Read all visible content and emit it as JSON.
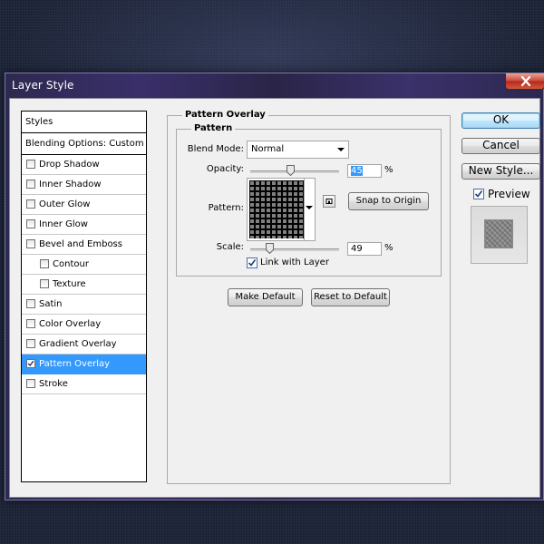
{
  "window": {
    "title": "Layer Style"
  },
  "styles_list": {
    "header": "Styles",
    "blending_options": "Blending Options: Custom",
    "items": [
      {
        "label": "Drop Shadow",
        "checked": false,
        "indent": false,
        "selected": false
      },
      {
        "label": "Inner Shadow",
        "checked": false,
        "indent": false,
        "selected": false
      },
      {
        "label": "Outer Glow",
        "checked": false,
        "indent": false,
        "selected": false
      },
      {
        "label": "Inner Glow",
        "checked": false,
        "indent": false,
        "selected": false
      },
      {
        "label": "Bevel and Emboss",
        "checked": false,
        "indent": false,
        "selected": false
      },
      {
        "label": "Contour",
        "checked": false,
        "indent": true,
        "selected": false
      },
      {
        "label": "Texture",
        "checked": false,
        "indent": true,
        "selected": false
      },
      {
        "label": "Satin",
        "checked": false,
        "indent": false,
        "selected": false
      },
      {
        "label": "Color Overlay",
        "checked": false,
        "indent": false,
        "selected": false
      },
      {
        "label": "Gradient Overlay",
        "checked": false,
        "indent": false,
        "selected": false
      },
      {
        "label": "Pattern Overlay",
        "checked": true,
        "indent": false,
        "selected": true
      },
      {
        "label": "Stroke",
        "checked": false,
        "indent": false,
        "selected": false
      }
    ]
  },
  "pattern_overlay": {
    "group_title": "Pattern Overlay",
    "subgroup_title": "Pattern",
    "blend_mode_label": "Blend Mode:",
    "blend_mode_value": "Normal",
    "opacity_label": "Opacity:",
    "opacity_value": "45",
    "opacity_unit": "%",
    "opacity_fraction": 0.45,
    "pattern_label": "Pattern:",
    "snap_to_origin": "Snap to Origin",
    "scale_label": "Scale:",
    "scale_value": "49",
    "scale_unit": "%",
    "scale_fraction": 0.22,
    "link_with_layer": "Link with Layer",
    "link_checked": true,
    "make_default": "Make Default",
    "reset_to_default": "Reset to Default"
  },
  "right_panel": {
    "ok": "OK",
    "cancel": "Cancel",
    "new_style": "New Style...",
    "preview_label": "Preview",
    "preview_checked": true
  },
  "colors": {
    "selection": "#3399ff",
    "close_button": "#c7463a",
    "title_bar": "#2f2a55"
  },
  "icons": [
    "close-icon",
    "checkmark-icon",
    "dropdown-arrow-icon",
    "slider-thumb-icon",
    "new-pattern-icon"
  ]
}
